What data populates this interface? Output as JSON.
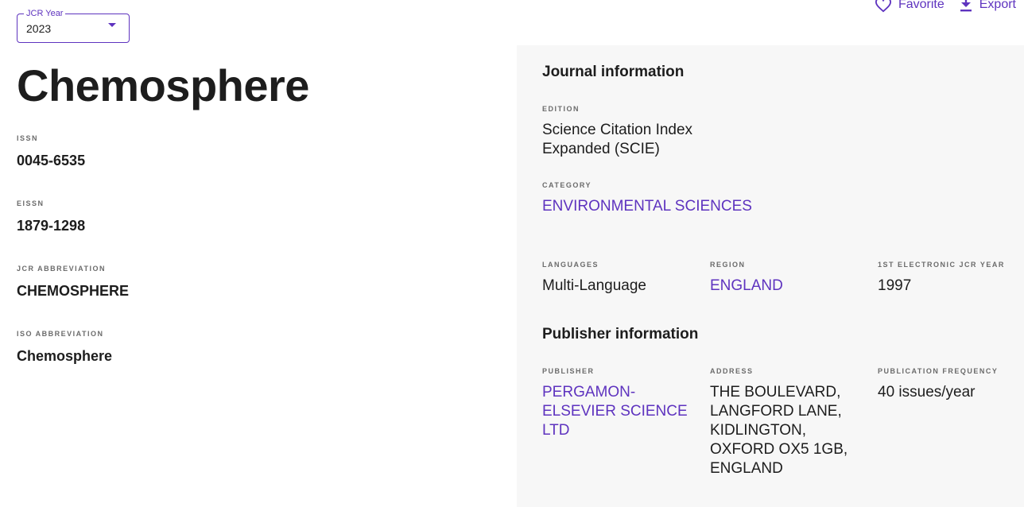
{
  "year_select": {
    "label": "JCR Year",
    "value": "2023"
  },
  "actions": {
    "favorite": "Favorite",
    "export": "Export"
  },
  "journal": {
    "title": "Chemosphere",
    "issn_label": "ISSN",
    "issn": "0045-6535",
    "eissn_label": "EISSN",
    "eissn": "1879-1298",
    "jcr_abbrev_label": "JCR ABBREVIATION",
    "jcr_abbrev": "CHEMOSPHERE",
    "iso_abbrev_label": "ISO ABBREVIATION",
    "iso_abbrev": "Chemosphere"
  },
  "journal_info": {
    "heading": "Journal information",
    "edition_label": "EDITION",
    "edition_line1": "Science Citation Index",
    "edition_line2": "Expanded (SCIE)",
    "category_label": "CATEGORY",
    "category": "ENVIRONMENTAL SCIENCES",
    "languages_label": "LANGUAGES",
    "languages": "Multi-Language",
    "region_label": "REGION",
    "region": "ENGLAND",
    "first_year_label": "1ST ELECTRONIC JCR YEAR",
    "first_year": "1997"
  },
  "publisher_info": {
    "heading": "Publisher information",
    "publisher_label": "PUBLISHER",
    "publisher_lines": [
      "PERGAMON-",
      "ELSEVIER SCIENCE",
      "LTD"
    ],
    "address_label": "ADDRESS",
    "address_lines": [
      "THE BOULEVARD,",
      "LANGFORD LANE,",
      "KIDLINGTON,",
      "OXFORD OX5 1GB,",
      "ENGLAND"
    ],
    "frequency_label": "PUBLICATION FREQUENCY",
    "frequency": "40 issues/year"
  },
  "icons": {
    "favorite": "heart-icon",
    "export": "download-icon",
    "year_caret": "caret-down-icon"
  },
  "colors": {
    "accent": "#5e33bf",
    "panel_bg": "#f7f7f7",
    "text": "#1d1d1d"
  }
}
